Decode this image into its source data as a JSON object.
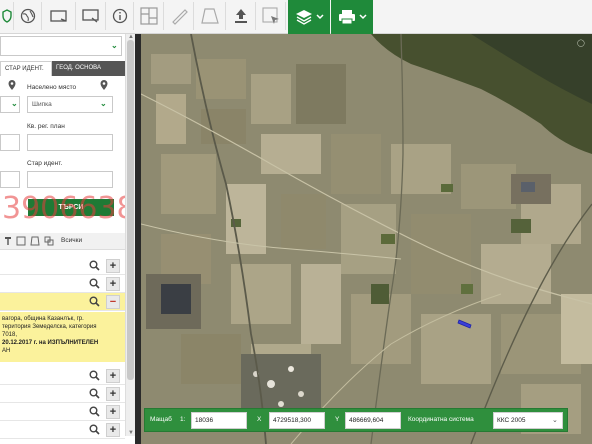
{
  "toolbar": {
    "icons": [
      "shield-icon",
      "globe-icon",
      "window-icon",
      "monitor-icon",
      "info-icon",
      "layout-icon",
      "ruler-icon",
      "area-icon",
      "upload-icon",
      "select-icon",
      "layers-icon",
      "print-icon"
    ],
    "accent": "#1f8a3a"
  },
  "panel": {
    "tabs": {
      "active": "СТАР ИДЕНТ.",
      "inactive": "ГЕОД. ОСНОВА"
    },
    "fields": {
      "settlement_label": "Населено място",
      "settlement_value": "Шипка",
      "reg_plan_label": "Кв. рег. план",
      "old_ident_label": "Стар идент."
    },
    "search_button": "ТЪРСИ",
    "watermark": "3906638",
    "layers": {
      "all_label": "Всички"
    },
    "info_lines": [
      "вагора, община Казанлък, гр.",
      "територия Земеделска, категория",
      "7018,",
      "20.12.2017 г. на ИЗПЪЛНИТЕЛЕН",
      "АН"
    ]
  },
  "coordbar": {
    "scale_label": "Мащаб",
    "scale_prefix": "1:",
    "scale_value": "18036",
    "x_label": "X",
    "x_value": "4729518,300",
    "y_label": "Y",
    "y_value": "486669,604",
    "system_label": "Координатна система",
    "system_value": "ККС 2005"
  }
}
